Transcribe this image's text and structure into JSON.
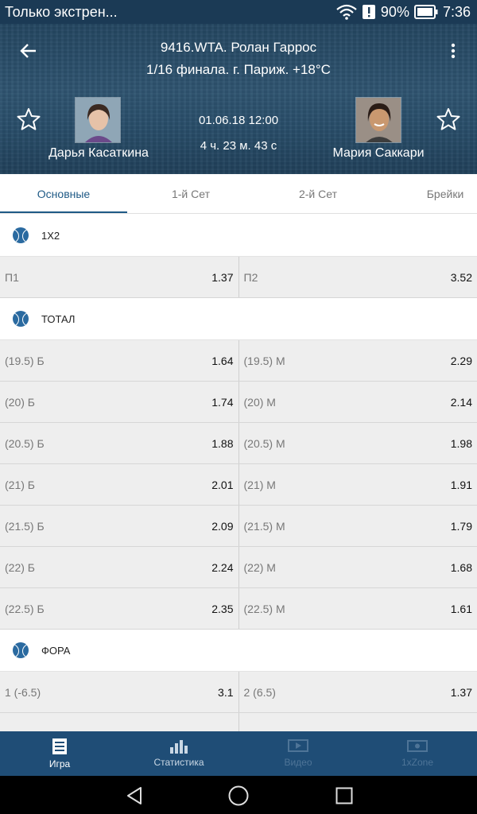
{
  "status_bar": {
    "notification": "Только экстрен...",
    "battery": "90%",
    "time": "7:36"
  },
  "header": {
    "title": "9416.WTA. Ролан Гаррос",
    "subtitle": "1/16 финала. г. Париж. +18°C",
    "player1": "Дарья Касаткина",
    "player2": "Мария Саккари",
    "date": "01.06.18 12:00",
    "elapsed": "4 ч. 23 м. 43 с"
  },
  "tabs": [
    "Основные",
    "1-й Сет",
    "2-й Сет",
    "Брейки"
  ],
  "sections": [
    {
      "title": "1X2",
      "rows": [
        [
          {
            "label": "П1",
            "value": "1.37"
          },
          {
            "label": "П2",
            "value": "3.52"
          }
        ]
      ]
    },
    {
      "title": "ТОТАЛ",
      "rows": [
        [
          {
            "label": "(19.5) Б",
            "value": "1.64"
          },
          {
            "label": "(19.5) М",
            "value": "2.29"
          }
        ],
        [
          {
            "label": "(20) Б",
            "value": "1.74"
          },
          {
            "label": "(20) М",
            "value": "2.14"
          }
        ],
        [
          {
            "label": "(20.5) Б",
            "value": "1.88"
          },
          {
            "label": "(20.5) М",
            "value": "1.98"
          }
        ],
        [
          {
            "label": "(21) Б",
            "value": "2.01"
          },
          {
            "label": "(21) М",
            "value": "1.91"
          }
        ],
        [
          {
            "label": "(21.5) Б",
            "value": "2.09"
          },
          {
            "label": "(21.5) М",
            "value": "1.79"
          }
        ],
        [
          {
            "label": "(22) Б",
            "value": "2.24"
          },
          {
            "label": "(22) М",
            "value": "1.68"
          }
        ],
        [
          {
            "label": "(22.5) Б",
            "value": "2.35"
          },
          {
            "label": "(22.5) М",
            "value": "1.61"
          }
        ]
      ]
    },
    {
      "title": "ФОРА",
      "rows": [
        [
          {
            "label": "1 (-6.5)",
            "value": "3.1"
          },
          {
            "label": "2 (6.5)",
            "value": "1.37"
          }
        ],
        [
          {
            "label": "",
            "value": ""
          },
          {
            "label": "",
            "value": ""
          }
        ]
      ]
    }
  ],
  "bottom_nav": [
    {
      "label": "Игра",
      "icon": "game-icon"
    },
    {
      "label": "Статистика",
      "icon": "stats-icon"
    },
    {
      "label": "Видео",
      "icon": "video-icon"
    },
    {
      "label": "1xZone",
      "icon": "zone-icon"
    }
  ],
  "colors": {
    "accent": "#1f5a86",
    "nav_bg": "#1f4d76",
    "ball": "#2a6aa0",
    "row_bg": "#eeeeee"
  }
}
